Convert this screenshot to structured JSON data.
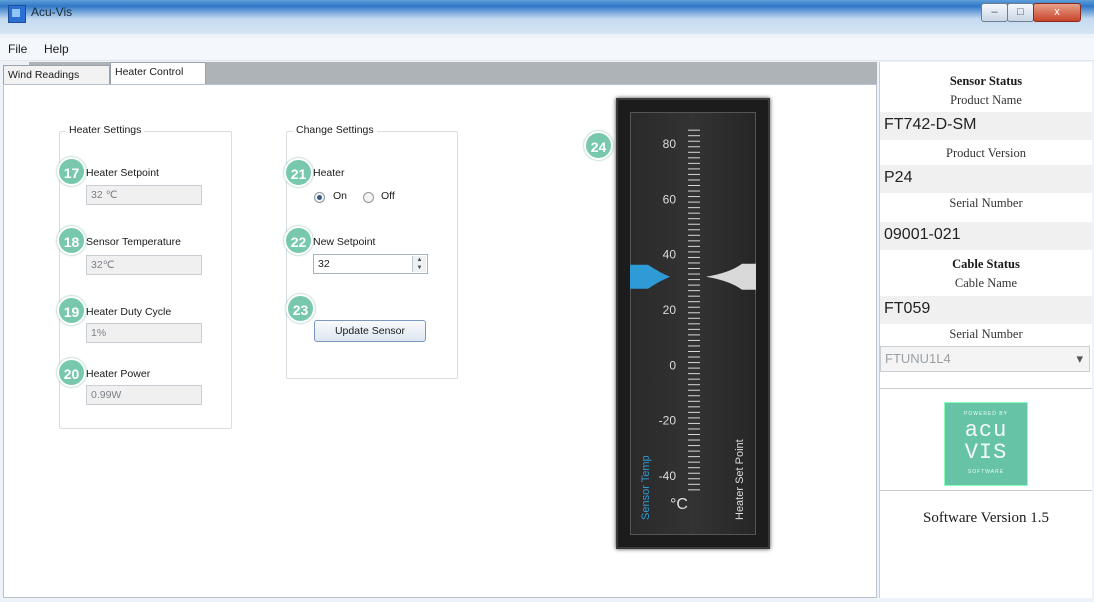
{
  "window": {
    "title": "Acu-Vis",
    "close_glyph": "x"
  },
  "menu": [
    "File",
    "Help"
  ],
  "tabs": [
    {
      "label": "Wind Readings",
      "active": false
    },
    {
      "label": "Heater Control",
      "active": true
    }
  ],
  "heater_settings": {
    "title": "Heater Settings",
    "fields": [
      {
        "badge": "17",
        "label": "Heater Setpoint",
        "value": "32 ℃"
      },
      {
        "badge": "18",
        "label": "Sensor Temperature",
        "value": "32℃"
      },
      {
        "badge": "19",
        "label": "Heater Duty Cycle",
        "value": "1%"
      },
      {
        "badge": "20",
        "label": "Heater Power",
        "value": "0.99W"
      }
    ]
  },
  "change_settings": {
    "title": "Change Settings",
    "heater_badge": "21",
    "heater_label": "Heater",
    "on_label": "On",
    "off_label": "Off",
    "heater_state": "On",
    "setpoint_badge": "22",
    "setpoint_label": "New Setpoint",
    "setpoint_value": "32",
    "update_badge": "23",
    "update_button": "Update Sensor"
  },
  "gauge": {
    "badge": "24",
    "ticks": [
      "80",
      "60",
      "40",
      "20",
      "0",
      "-20",
      "-40"
    ],
    "tick_values": [
      80,
      60,
      40,
      20,
      0,
      -20,
      -40
    ],
    "unit": "°C",
    "left_label": "Sensor Temp",
    "right_label": "Heater Set Point",
    "sensor_temp": 32,
    "heater_set_point": 32,
    "min": -40,
    "max": 80,
    "sensor_color": "#2f9bd6",
    "setpoint_color": "#d9d9d9"
  },
  "status": {
    "sensor_status": "Sensor Status",
    "product_name_label": "Product Name",
    "product_name": "FT742-D-SM",
    "product_version_label": "Product Version",
    "product_version": "P24",
    "serial_number_label": "Serial Number",
    "serial_number": "09001-021",
    "cable_status": "Cable Status",
    "cable_name_label": "Cable Name",
    "cable_name": "FT059",
    "cable_serial_label": "Serial Number",
    "cable_serial": "FTUNU1L4",
    "logo_powered": "POWERED BY",
    "logo_acu": "acu",
    "logo_vis": "VIS",
    "logo_software": "SOFTWARE",
    "software_version": "Software Version 1.5"
  }
}
